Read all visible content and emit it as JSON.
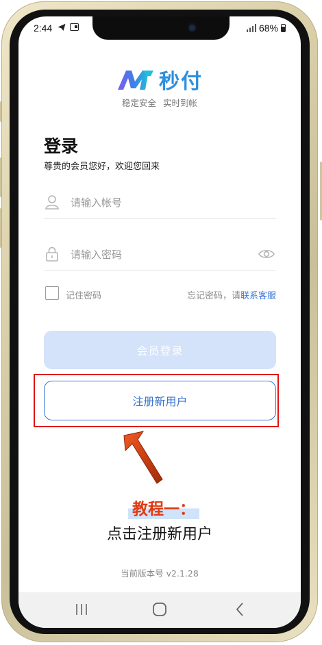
{
  "status_bar": {
    "time": "2:44",
    "battery": "68%"
  },
  "brand": {
    "name": "秒付",
    "slogan": "稳定安全 实时到帐"
  },
  "login": {
    "title": "登录",
    "welcome": "尊贵的会员您好，欢迎您回来",
    "account_placeholder": "请输入帐号",
    "password_placeholder": "请输入密码",
    "remember_label": "记住密码",
    "forgot_prefix": "忘记密码，请",
    "forgot_link": "联系客服",
    "login_button": "会员登录",
    "register_button": "注册新用户"
  },
  "tutorial": {
    "title": "教程一：",
    "instruction": "点击注册新用户"
  },
  "footer": {
    "version_label": "当前版本号 v2.1.28"
  },
  "colors": {
    "accent": "#3a76d4",
    "brand": "#2f8fdc",
    "highlight_red": "#e01414",
    "tutorial_orange": "#e03a12",
    "login_button_disabled": "#d4e2fa"
  },
  "icons": [
    "telegram-icon",
    "cast-icon",
    "signal-icon",
    "battery-icon",
    "user-icon",
    "lock-icon",
    "eye-icon",
    "checkbox-icon",
    "arrow-icon",
    "recents-icon",
    "home-icon",
    "back-icon"
  ]
}
